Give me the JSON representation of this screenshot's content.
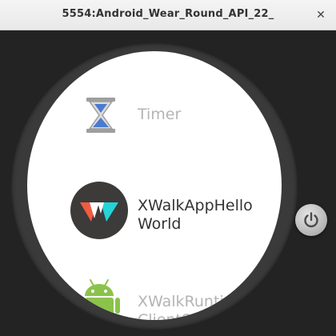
{
  "window": {
    "title": "5554:Android_Wear_Round_API_22_",
    "close_glyph": "✕"
  },
  "apps": [
    {
      "label": "Timer",
      "icon": "hourglass-icon",
      "selected": false
    },
    {
      "label": "XWalkAppHelloWorld",
      "icon": "xwalk-logo-icon",
      "selected": true
    },
    {
      "label": "XWalkRuntimeClientShell",
      "icon": "android-robot-icon",
      "selected": false
    }
  ],
  "colors": {
    "android_green": "#8bc34a",
    "xwalk_dark": "#3c3b3a",
    "xwalk_orange": "#f15b40",
    "xwalk_teal": "#25d3d8",
    "timer_blue": "#4a7bd0"
  },
  "side_button": {
    "icon": "power-icon"
  }
}
